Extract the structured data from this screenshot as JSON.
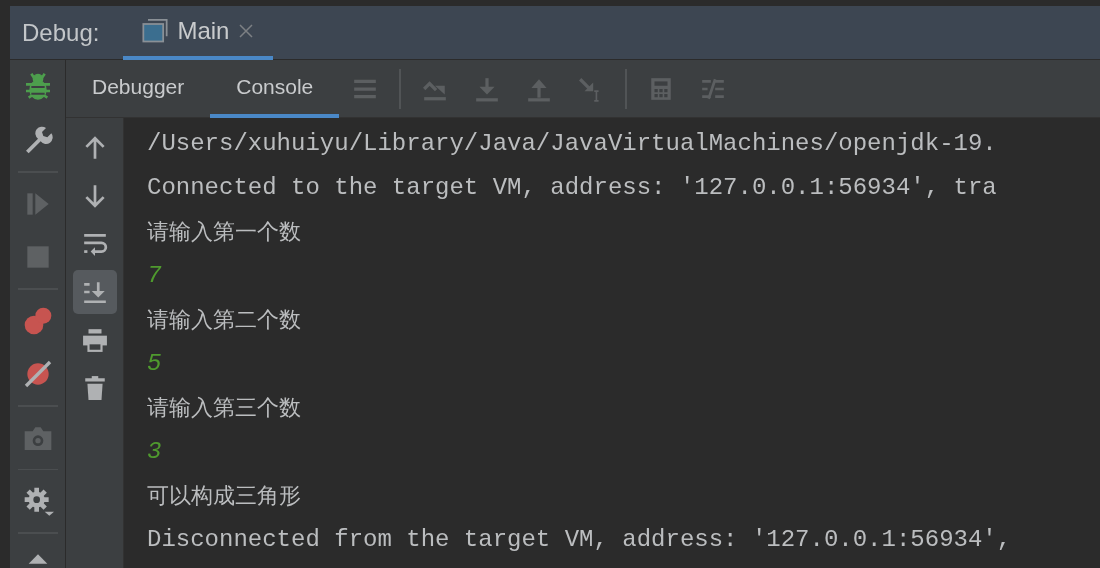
{
  "header": {
    "label": "Debug:",
    "tabs": [
      {
        "label": "Main",
        "selected": true
      }
    ]
  },
  "side_tools": [
    {
      "kind": "bug",
      "disabled": false
    },
    {
      "kind": "wrench",
      "disabled": false
    },
    {
      "kind": "sep"
    },
    {
      "kind": "resume",
      "disabled": true
    },
    {
      "kind": "stop",
      "disabled": true
    },
    {
      "kind": "sep"
    },
    {
      "kind": "breakpoints",
      "disabled": false
    },
    {
      "kind": "mute",
      "disabled": false
    },
    {
      "kind": "sep"
    },
    {
      "kind": "camera",
      "disabled": true
    },
    {
      "kind": "sep"
    },
    {
      "kind": "gear",
      "disabled": false
    },
    {
      "kind": "sep"
    },
    {
      "kind": "caret",
      "disabled": false
    }
  ],
  "tabs": [
    {
      "label": "Debugger",
      "selected": false
    },
    {
      "label": "Console",
      "selected": true
    }
  ],
  "toolbar": [
    {
      "kind": "menu"
    },
    {
      "kind": "sep"
    },
    {
      "kind": "stepover"
    },
    {
      "kind": "stepinto"
    },
    {
      "kind": "stepout"
    },
    {
      "kind": "cursor"
    },
    {
      "kind": "sep"
    },
    {
      "kind": "calc"
    },
    {
      "kind": "trace"
    }
  ],
  "console_tools": [
    {
      "kind": "up",
      "active": false
    },
    {
      "kind": "down",
      "active": false
    },
    {
      "kind": "wrap",
      "active": false
    },
    {
      "kind": "scrollend",
      "active": true
    },
    {
      "kind": "print",
      "active": false
    },
    {
      "kind": "trash",
      "active": false
    }
  ],
  "lines": [
    {
      "kind": "system",
      "text": "/Users/xuhuiyu/Library/Java/JavaVirtualMachines/openjdk-19."
    },
    {
      "kind": "system",
      "text": "Connected to the target VM, address: '127.0.0.1:56934', tra"
    },
    {
      "kind": "output",
      "text": "请输入第一个数"
    },
    {
      "kind": "input",
      "text": "7"
    },
    {
      "kind": "output",
      "text": "请输入第二个数"
    },
    {
      "kind": "input",
      "text": "5"
    },
    {
      "kind": "output",
      "text": "请输入第三个数"
    },
    {
      "kind": "input",
      "text": "3"
    },
    {
      "kind": "output",
      "text": "可以构成三角形"
    },
    {
      "kind": "system",
      "text": "Disconnected from the target VM, address: '127.0.0.1:56934',"
    }
  ]
}
